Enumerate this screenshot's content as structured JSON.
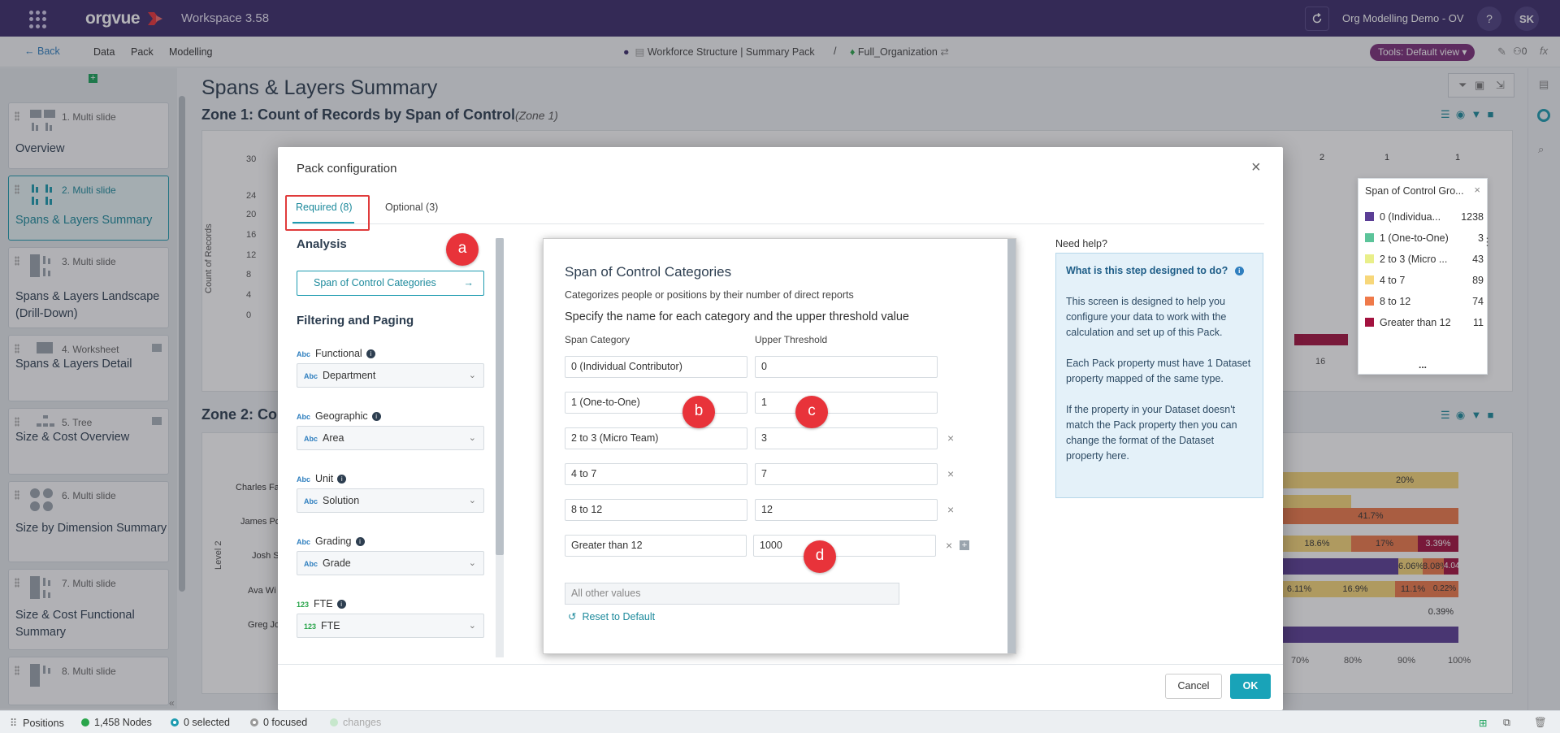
{
  "app": {
    "brand": "orgvue",
    "workspace_title": "Workspace 3.58",
    "org_demo": "Org Modelling Demo - OV",
    "help": "?",
    "user_initials": "SK"
  },
  "menu": {
    "back": "Back",
    "items": [
      "Data",
      "Pack",
      "Modelling"
    ],
    "crumb_pack": "Workforce Structure | Summary Pack",
    "crumb_sep": "/",
    "crumb_dataset": "Full_Organization",
    "tools": "Tools: Default view",
    "count": "0"
  },
  "sidebar": {
    "slides": [
      {
        "num": "1. Multi slide",
        "title": "Overview"
      },
      {
        "num": "2. Multi slide",
        "title": "Spans & Layers Summary"
      },
      {
        "num": "3. Multi slide",
        "title": "Spans & Layers Landscape (Drill-Down)"
      },
      {
        "num": "4. Worksheet",
        "title": "Spans & Layers Detail"
      },
      {
        "num": "5. Tree",
        "title": "Size & Cost Overview"
      },
      {
        "num": "6. Multi slide",
        "title": "Size by Dimension Summary"
      },
      {
        "num": "7. Multi slide",
        "title": "Size & Cost Functional Summary"
      },
      {
        "num": "8. Multi slide",
        "title": ""
      }
    ]
  },
  "main": {
    "title": "Spans & Layers Summary",
    "zone1_title": "Zone 1: Count of Records by Span of Control",
    "zone1_sub": "(Zone 1)",
    "zone2_title": "Zone 2: Co",
    "y_axis_label": "Count of Records",
    "y_ticks": [
      "30",
      "24",
      "20",
      "16",
      "12",
      "8",
      "4",
      "0"
    ],
    "top_values": [
      "2",
      "1",
      "1"
    ],
    "x_tick_16": "16",
    "level_label": "Level 2",
    "names": [
      "Charles Fa",
      "James Po",
      "Josh S",
      "Ava Wi",
      "Greg Jo"
    ],
    "bar_labels": [
      "20%",
      "41.7%",
      "18.6%",
      "17%",
      "3.39%",
      "6.06%",
      "8.08%",
      "4.04%",
      "6.11%",
      "16.9%",
      "11.1%",
      "0.22%",
      "0.39%"
    ],
    "pct_ticks": [
      "70%",
      "80%",
      "90%",
      "100%"
    ]
  },
  "legend": {
    "title": "Span of Control Gro...",
    "rows": [
      {
        "label": "0 (Individua...",
        "count": "1238",
        "color": "#5b3e96"
      },
      {
        "label": "1 (One-to-One)",
        "count": "3",
        "color": "#5cc49a"
      },
      {
        "label": "2 to 3 (Micro ...",
        "count": "43",
        "color": "#e9ef8a"
      },
      {
        "label": "4 to 7",
        "count": "89",
        "color": "#f7d77a"
      },
      {
        "label": "8 to 12",
        "count": "74",
        "color": "#ef7a4a"
      },
      {
        "label": "Greater than 12",
        "count": "11",
        "color": "#a3123f"
      }
    ],
    "more": "..."
  },
  "modal": {
    "title": "Pack configuration",
    "close": "×",
    "tabs": {
      "required": "Required (8)",
      "optional": "Optional (3)"
    },
    "analysis_head": "Analysis",
    "soc_button": "Span of Control Categories",
    "filtering_head": "Filtering and Paging",
    "props": [
      {
        "label": "Functional",
        "type": "Abc",
        "value": "Department"
      },
      {
        "label": "Geographic",
        "type": "Abc",
        "value": "Area"
      },
      {
        "label": "Unit",
        "type": "Abc",
        "value": "Solution"
      },
      {
        "label": "Grading",
        "type": "Abc",
        "value": "Grade"
      },
      {
        "label": "FTE",
        "type": "123",
        "value": "FTE"
      }
    ],
    "card": {
      "title": "Span of Control Categories",
      "desc": "Categorizes people or positions by their number of direct reports",
      "spec": "Specify the name for each category and the upper threshold value",
      "col_category": "Span Category",
      "col_threshold": "Upper Threshold",
      "rows": [
        {
          "category": "0 (Individual Contributor)",
          "threshold": "0"
        },
        {
          "category": "1 (One-to-One)",
          "threshold": "1"
        },
        {
          "category": "2 to 3 (Micro Team)",
          "threshold": "3"
        },
        {
          "category": "4 to 7",
          "threshold": "7"
        },
        {
          "category": "8 to 12",
          "threshold": "12"
        },
        {
          "category": "Greater than 12",
          "threshold": "1000"
        }
      ],
      "all_other": "All other values",
      "reset": "Reset to Default"
    },
    "help": {
      "need_help": "Need help?",
      "question": "What is this step designed to do?",
      "p1": "This screen is designed to help you configure your data to work with the calculation and set up of this Pack.",
      "p2": "Each Pack property must have 1 Dataset property mapped of the same type.",
      "p3": "If the property in your Dataset doesn't match the Pack property then you can change the format of the Dataset property here."
    },
    "cancel": "Cancel",
    "ok": "OK"
  },
  "markers": {
    "a": "a",
    "b": "b",
    "c": "c",
    "d": "d"
  },
  "status": {
    "positions": "Positions",
    "nodes": "1,458 Nodes",
    "selected": "0 selected",
    "focused": "0 focused",
    "changes": "changes"
  }
}
